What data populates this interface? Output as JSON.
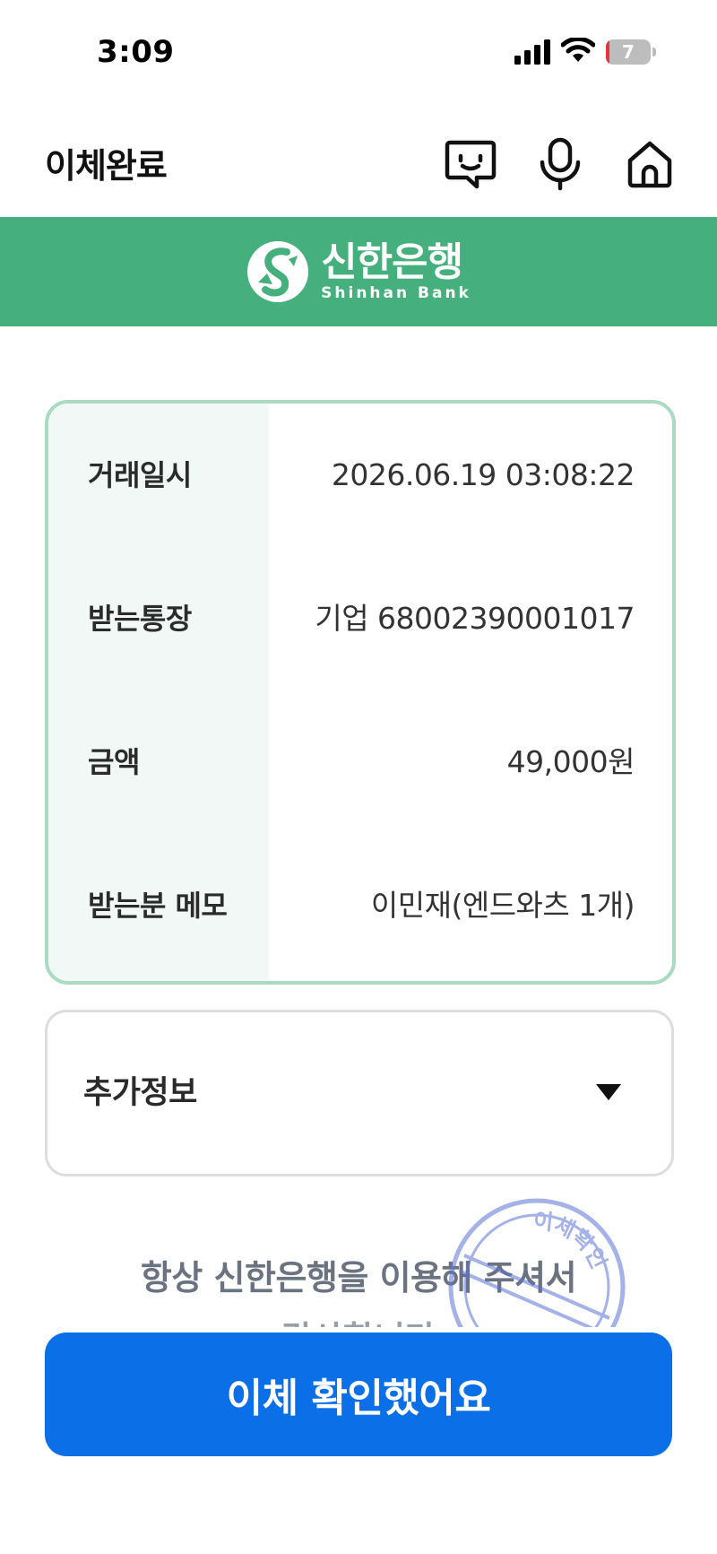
{
  "status_bar": {
    "time": "3:09",
    "battery_level": "7",
    "battery_fraction": 0.07
  },
  "header": {
    "title": "이체완료",
    "icons": [
      "chatbot-icon",
      "microphone-icon",
      "home-icon"
    ]
  },
  "banner": {
    "logo_korean": "신한은행",
    "logo_english": "Shinhan Bank",
    "background_color": "#45b07d"
  },
  "details": [
    {
      "label": "거래일시",
      "value": "2026.06.19 03:08:22"
    },
    {
      "label": "받는통장",
      "value": "기업 68002390001017"
    },
    {
      "label": "금액",
      "value": "49,000원"
    },
    {
      "label": "받는분 메모",
      "value": "이민재(엔드와츠 1개)"
    }
  ],
  "extra_info": {
    "label": "추가정보"
  },
  "thanks": {
    "line1": "항상 신한은행을 이용해 주셔서",
    "line2": "감사합니다",
    "stamp_text": "이체확인"
  },
  "confirm_button": {
    "label": "이체 확인했어요",
    "color": "#0b6fe8"
  }
}
